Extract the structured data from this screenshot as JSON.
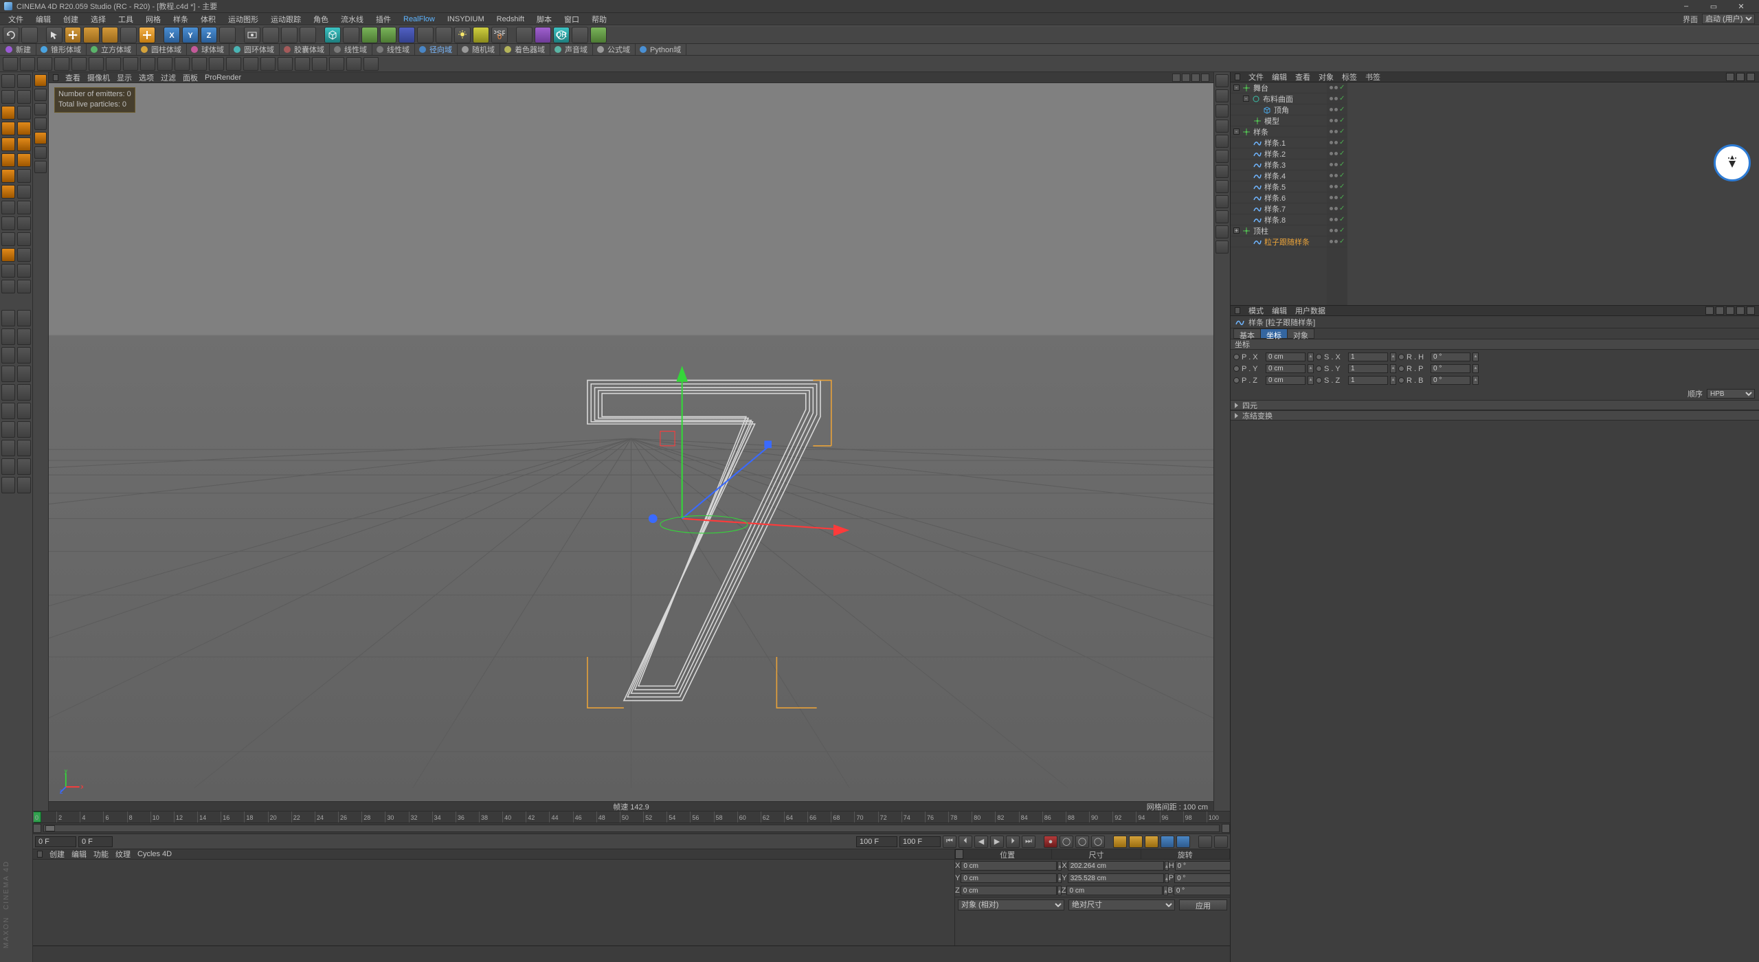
{
  "window": {
    "title": "CINEMA 4D R20.059 Studio (RC - R20) - [教程.c4d *] - 主要",
    "min": "–",
    "max": "▭",
    "close": "✕"
  },
  "menu": {
    "items": [
      "文件",
      "编辑",
      "创建",
      "选择",
      "工具",
      "网格",
      "样条",
      "体积",
      "运动图形",
      "运动跟踪",
      "角色",
      "流水线",
      "插件",
      "RealFlow",
      "INSYDIUM",
      "Redshift",
      "脚本",
      "窗口",
      "帮助"
    ],
    "hi_index": 13,
    "layout_label": "界面",
    "layout_value": "启动 (用户)"
  },
  "shelf": {
    "groups": [
      {
        "label": "新建"
      },
      {
        "label": "锥形体域"
      },
      {
        "label": "立方体域"
      },
      {
        "label": "圆柱体域"
      },
      {
        "label": "球体域"
      },
      {
        "label": "圆环体域"
      },
      {
        "label": "胶囊体域"
      },
      {
        "label": "线性域"
      },
      {
        "label": "线性域"
      },
      {
        "label": "径向域",
        "hi": true
      },
      {
        "label": "随机域"
      },
      {
        "label": "着色器域"
      },
      {
        "label": "声音域"
      },
      {
        "label": "公式域"
      },
      {
        "label": "Python域"
      }
    ]
  },
  "vp": {
    "menu": [
      "查看",
      "摄像机",
      "显示",
      "选项",
      "过滤",
      "面板",
      "ProRender"
    ],
    "hud_line1": "Number of emitters: 0",
    "hud_line2": "Total live particles: 0",
    "status_mid": "帧速  142.9",
    "status_right": "网格间距 : 100 cm"
  },
  "timeline": {
    "frames": [
      "0",
      "2",
      "4",
      "6",
      "8",
      "10",
      "12",
      "14",
      "16",
      "18",
      "20",
      "22",
      "24",
      "26",
      "28",
      "30",
      "32",
      "34",
      "36",
      "38",
      "40",
      "42",
      "44",
      "46",
      "48",
      "50",
      "52",
      "54",
      "56",
      "58",
      "60",
      "62",
      "64",
      "66",
      "68",
      "70",
      "72",
      "74",
      "76",
      "78",
      "80",
      "82",
      "84",
      "86",
      "88",
      "90",
      "92",
      "94",
      "96",
      "98",
      "100"
    ],
    "start": "0 F",
    "cur": "0 F",
    "end1": "100 F",
    "end2": "100 F"
  },
  "matpanel": {
    "tabs": [
      "创建",
      "编辑",
      "功能",
      "纹理",
      "Cycles 4D"
    ]
  },
  "coord": {
    "hdr": [
      "位置",
      "尺寸",
      "旋转"
    ],
    "rows": [
      {
        "axis": "X",
        "pos": "0 cm",
        "size_lbl": "X",
        "size": "202.264 cm",
        "rot_lbl": "H",
        "rot": "0 °"
      },
      {
        "axis": "Y",
        "pos": "0 cm",
        "size_lbl": "Y",
        "size": "325.528 cm",
        "rot_lbl": "P",
        "rot": "0 °"
      },
      {
        "axis": "Z",
        "pos": "0 cm",
        "size_lbl": "Z",
        "size": "0 cm",
        "rot_lbl": "B",
        "rot": "0 °"
      }
    ],
    "sel1": "对象 (相对)",
    "sel2": "绝对尺寸",
    "apply": "应用"
  },
  "objtabs": [
    "文件",
    "编辑",
    "查看",
    "对象",
    "标签",
    "书签"
  ],
  "tree": [
    {
      "d": 0,
      "exp": "-",
      "ic": "null",
      "nm": "舞台"
    },
    {
      "d": 1,
      "exp": "-",
      "ic": "sub",
      "nm": "布料曲面"
    },
    {
      "d": 2,
      "exp": "",
      "ic": "cube",
      "nm": "顶角"
    },
    {
      "d": 1,
      "exp": "",
      "ic": "null",
      "nm": "模型"
    },
    {
      "d": 0,
      "exp": "-",
      "ic": "null",
      "nm": "样条"
    },
    {
      "d": 1,
      "exp": "",
      "ic": "spline",
      "nm": "样条.1"
    },
    {
      "d": 1,
      "exp": "",
      "ic": "spline",
      "nm": "样条.2"
    },
    {
      "d": 1,
      "exp": "",
      "ic": "spline",
      "nm": "样条.3"
    },
    {
      "d": 1,
      "exp": "",
      "ic": "spline",
      "nm": "样条.4"
    },
    {
      "d": 1,
      "exp": "",
      "ic": "spline",
      "nm": "样条.5"
    },
    {
      "d": 1,
      "exp": "",
      "ic": "spline",
      "nm": "样条.6"
    },
    {
      "d": 1,
      "exp": "",
      "ic": "spline",
      "nm": "样条.7"
    },
    {
      "d": 1,
      "exp": "",
      "ic": "spline",
      "nm": "样条.8"
    },
    {
      "d": 0,
      "exp": "+",
      "ic": "null",
      "nm": "顶柱"
    },
    {
      "d": 1,
      "exp": "",
      "ic": "spline",
      "nm": "粒子跟随样条",
      "sel": true
    }
  ],
  "attr": {
    "tabs": [
      "模式",
      "编辑",
      "用户数据"
    ],
    "obj_label": "样条 [粒子跟随样条]",
    "subtabs": [
      "基本",
      "坐标",
      "对象"
    ],
    "subtab_active": 1,
    "sect1": "坐标",
    "rows": [
      {
        "l": "P . X",
        "v": "0 cm",
        "l2": "S . X",
        "v2": "1",
        "l3": "R . H",
        "v3": "0 °"
      },
      {
        "l": "P . Y",
        "v": "0 cm",
        "l2": "S . Y",
        "v2": "1",
        "l3": "R . P",
        "v3": "0 °"
      },
      {
        "l": "P . Z",
        "v": "0 cm",
        "l2": "S . Z",
        "v2": "1",
        "l3": "R . B",
        "v3": "0 °"
      }
    ],
    "order_label": "顺序",
    "order_value": "HPB",
    "coll1": "四元",
    "coll2": "冻结变换"
  }
}
